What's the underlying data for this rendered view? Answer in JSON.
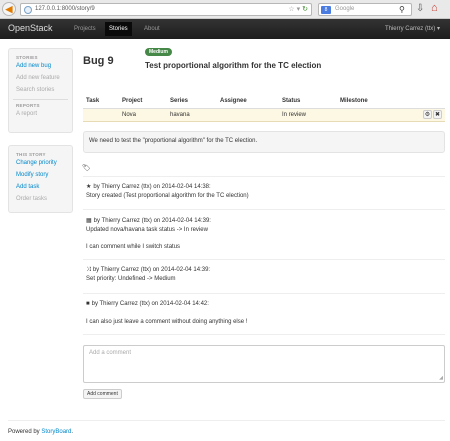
{
  "browser": {
    "url": "127.0.0.1:8000/story/9",
    "search_placeholder": "Google",
    "search_engine_label": "8"
  },
  "navbar": {
    "brand": "OpenStack",
    "items": [
      {
        "label": "Projects",
        "active": false
      },
      {
        "label": "Stories",
        "active": true
      },
      {
        "label": "About",
        "active": false
      }
    ],
    "user": "Thierry Carrez (ttx)"
  },
  "sidebar": {
    "stories": {
      "heading": "STORIES",
      "items": [
        {
          "label": "Add new bug",
          "enabled": true
        },
        {
          "label": "Add new feature",
          "enabled": false
        },
        {
          "label": "Search stories",
          "enabled": false
        }
      ],
      "reports_heading": "REPORTS",
      "reports_items": [
        {
          "label": "A report",
          "enabled": false
        }
      ]
    },
    "this_story": {
      "heading": "THIS STORY",
      "items": [
        {
          "label": "Change priority",
          "enabled": true
        },
        {
          "label": "Modify story",
          "enabled": true
        },
        {
          "label": "Add task",
          "enabled": true
        },
        {
          "label": "Order tasks",
          "enabled": false
        }
      ]
    }
  },
  "story": {
    "bug_label": "Bug 9",
    "priority": "Medium",
    "priority_color": "#468847",
    "title": "Test proportional algorithm for the TC election",
    "description": "We need to test the \"proportional algorithm\" for the TC election."
  },
  "tasks_table": {
    "headers": [
      "Task",
      "Project",
      "Series",
      "Assignee",
      "Status",
      "Milestone"
    ],
    "rows": [
      {
        "task": "",
        "project": "Nova",
        "series": "havana",
        "assignee": "",
        "status": "In review",
        "milestone": ""
      }
    ]
  },
  "events": [
    {
      "icon": "star-icon",
      "glyph": "★",
      "header": "by Thierry Carrez (ttx) on 2014-02-04 14:38:",
      "body": "Story created (Test proportional algorithm for the TC election)"
    },
    {
      "icon": "list-icon",
      "glyph": "▦",
      "header": "by Thierry Carrez (ttx) on 2014-02-04 14:39:",
      "body": "Updated nova/havana task status -> In review",
      "comment": "I can comment while I switch status"
    },
    {
      "icon": "random-icon",
      "glyph": "⤨",
      "header": "by Thierry Carrez (ttx) on 2014-02-04 14:39:",
      "body": "Set priority: Undefined -> Medium"
    },
    {
      "icon": "comment-icon",
      "glyph": "■",
      "header": "by Thierry Carrez (ttx) on 2014-02-04 14:42:",
      "comment": "I can also just leave a comment without doing anything else !"
    }
  ],
  "comment_form": {
    "placeholder": "Add a comment",
    "button_label": "Add comment"
  },
  "footer": {
    "prefix": "Powered by ",
    "link": "StoryBoard",
    "suffix": "."
  }
}
